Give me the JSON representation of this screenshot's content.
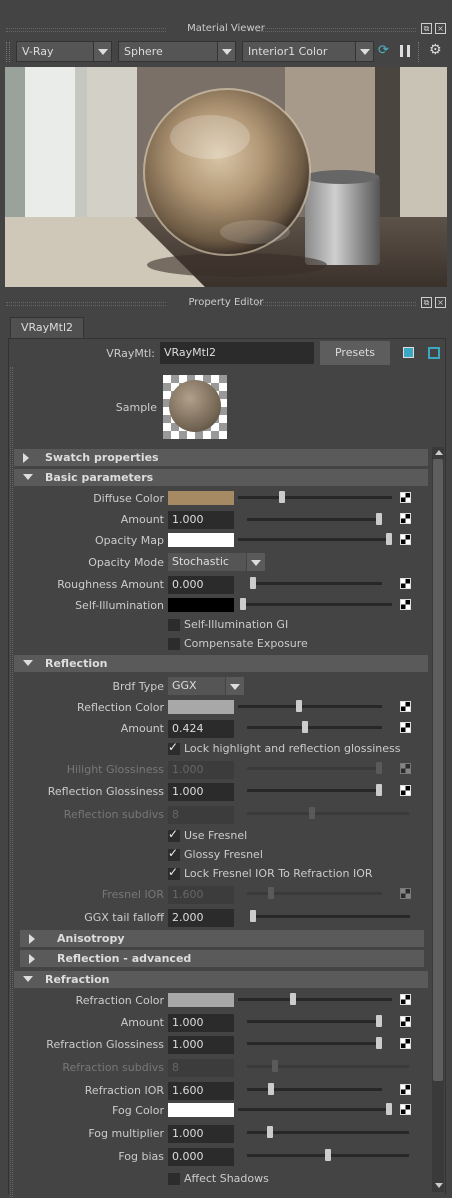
{
  "material_viewer": {
    "title": "Material Viewer",
    "renderer": "V-Ray",
    "shape": "Sphere",
    "environment": "Interior1 Color"
  },
  "property_editor": {
    "title": "Property Editor",
    "tab": "VRayMtl2",
    "node_label": "VRayMtl:",
    "node_name": "VRayMtl2",
    "presets_label": "Presets",
    "sample_label": "Sample"
  },
  "sections": {
    "swatch": "Swatch properties",
    "basic": "Basic parameters",
    "reflection": "Reflection",
    "anisotropy": "Anisotropy",
    "reflection_adv": "Reflection - advanced",
    "refraction": "Refraction"
  },
  "basic": {
    "diffuse_color": {
      "label": "Diffuse Color",
      "color": "#a58a63",
      "slider": 0.28
    },
    "amount": {
      "label": "Amount",
      "value": "1.000",
      "slider": 1.0
    },
    "opacity_map": {
      "label": "Opacity Map",
      "color": "#ffffff",
      "slider": 1.0
    },
    "opacity_mode": {
      "label": "Opacity Mode",
      "value": "Stochastic"
    },
    "roughness": {
      "label": "Roughness Amount",
      "value": "0.000",
      "slider": 0.0
    },
    "self_illum": {
      "label": "Self-Illumination",
      "color": "#000000",
      "slider": 0.0
    },
    "self_illum_gi": {
      "label": "Self-Illumination GI",
      "checked": false
    },
    "compensate": {
      "label": "Compensate Exposure",
      "checked": false
    }
  },
  "reflection": {
    "brdf_type": {
      "label": "Brdf Type",
      "value": "GGX"
    },
    "refl_color": {
      "label": "Reflection Color",
      "color": "#a8a8a8",
      "slider": 0.42
    },
    "amount": {
      "label": "Amount",
      "value": "0.424",
      "slider": 0.424
    },
    "lock_hilight": {
      "label": "Lock highlight and reflection glossiness",
      "checked": true
    },
    "hilight_gloss": {
      "label": "Hilight Glossiness",
      "value": "1.000",
      "slider": 1.0
    },
    "refl_gloss": {
      "label": "Reflection Glossiness",
      "value": "1.000",
      "slider": 1.0
    },
    "refl_subdivs": {
      "label": "Reflection subdivs",
      "value": "8",
      "slider": 0.4
    },
    "use_fresnel": {
      "label": "Use Fresnel",
      "checked": true
    },
    "glossy_fresnel": {
      "label": "Glossy Fresnel",
      "checked": true
    },
    "lock_fresnel": {
      "label": "Lock Fresnel IOR To Refraction IOR",
      "checked": true
    },
    "fresnel_ior": {
      "label": "Fresnel IOR",
      "value": "1.600",
      "slider": 0.16
    },
    "ggx_tail": {
      "label": "GGX tail falloff",
      "value": "2.000",
      "slider": 0.0
    }
  },
  "refraction": {
    "refr_color": {
      "label": "Refraction Color",
      "color": "#a8a8a8",
      "slider": 0.35
    },
    "amount": {
      "label": "Amount",
      "value": "1.000",
      "slider": 1.0
    },
    "refr_gloss": {
      "label": "Refraction Glossiness",
      "value": "1.000",
      "slider": 1.0
    },
    "refr_subdivs": {
      "label": "Refraction subdivs",
      "value": "8",
      "slider": 0.16
    },
    "refr_ior": {
      "label": "Refraction IOR",
      "value": "1.600",
      "slider": 0.16
    },
    "fog_color": {
      "label": "Fog Color",
      "color": "#ffffff",
      "slider": 1.0
    },
    "fog_mult": {
      "label": "Fog multiplier",
      "value": "1.000",
      "slider": 0.13
    },
    "fog_bias": {
      "label": "Fog bias",
      "value": "0.000",
      "slider": 0.5
    },
    "affect_shadows": {
      "label": "Affect Shadows",
      "checked": false
    }
  }
}
